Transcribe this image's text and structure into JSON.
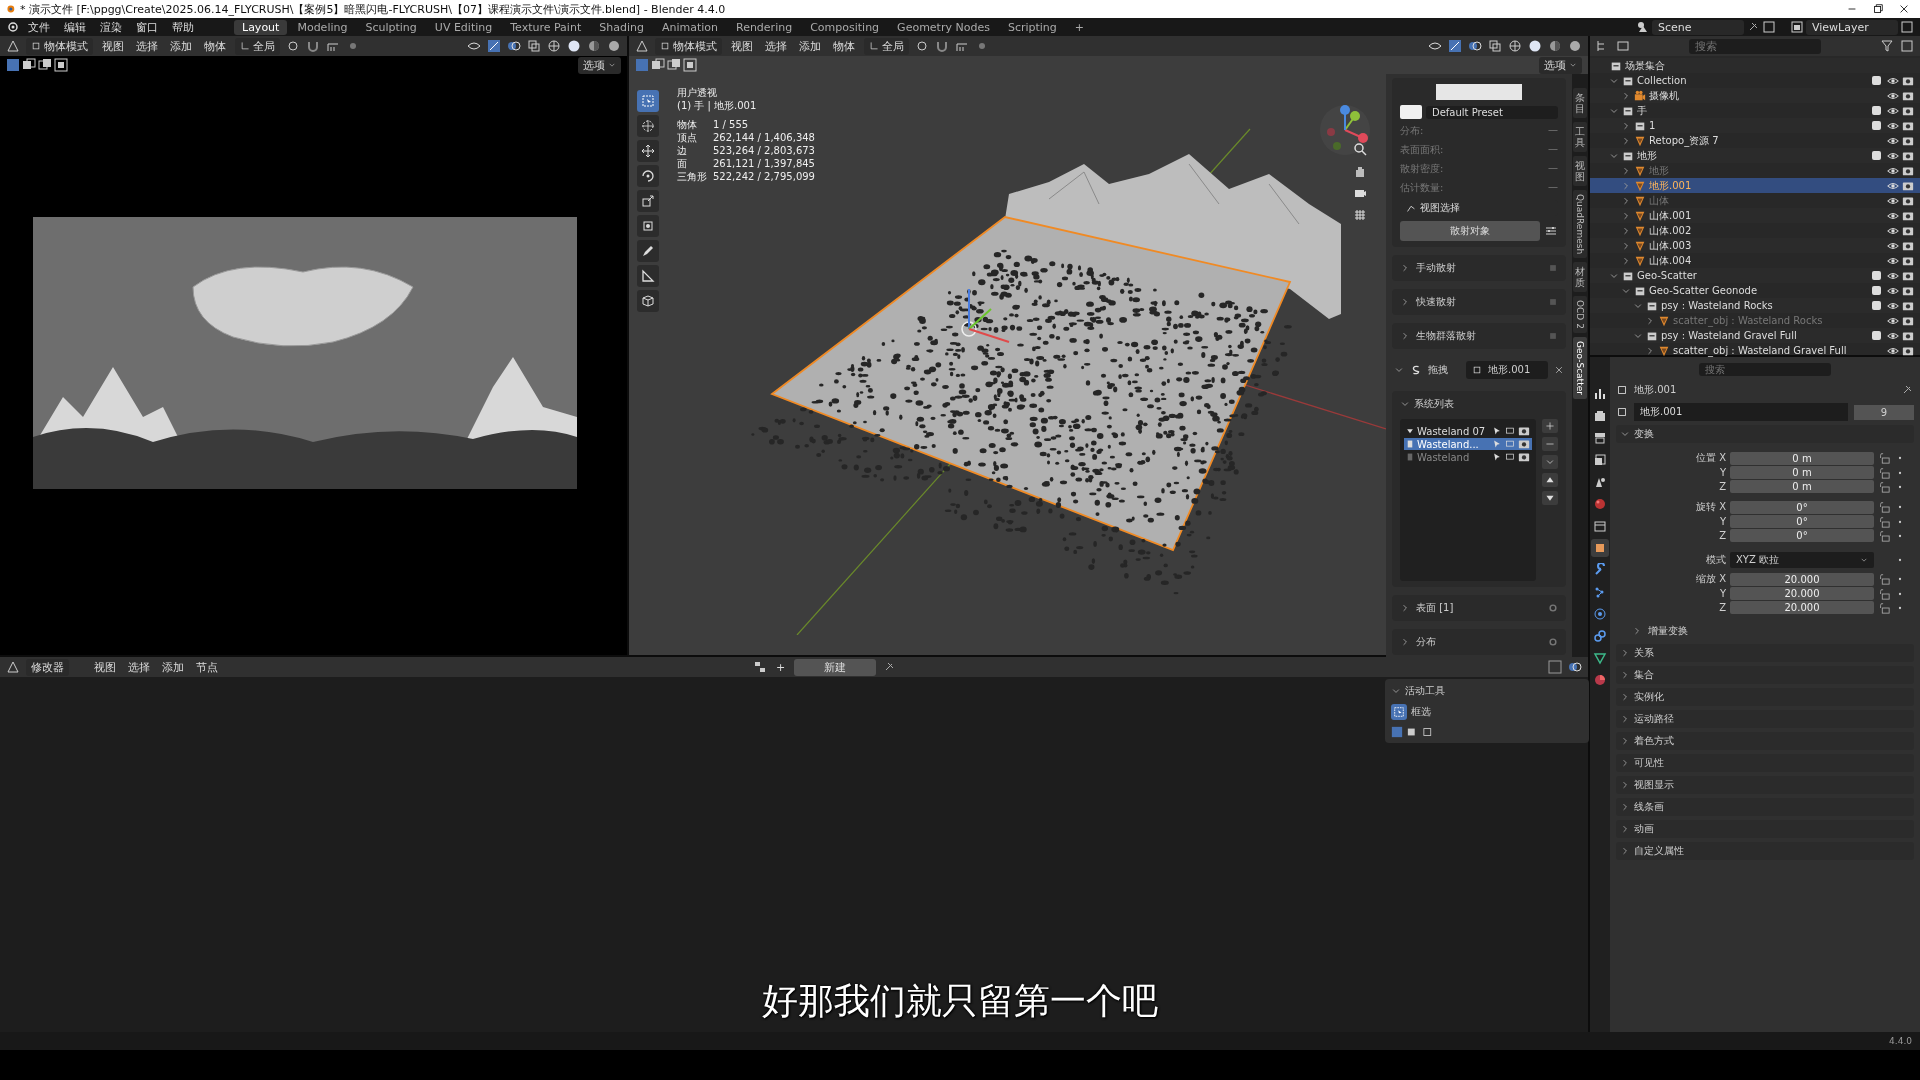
{
  "title_bar": {
    "title": "* 演示文件 [F:\\ppgg\\Create\\2025.06.14_FLYCRUSH\\【案例5】暗黑闪电-FLYCRUSH\\【07】课程演示文件\\演示文件.blend] - Blender 4.4.0"
  },
  "menu_bar": {
    "menus": [
      "文件",
      "编辑",
      "渲染",
      "窗口",
      "帮助"
    ],
    "workspaces": [
      {
        "label": "Layout",
        "selected": true
      },
      {
        "label": "Modeling",
        "selected": false
      },
      {
        "label": "Sculpting",
        "selected": false
      },
      {
        "label": "UV Editing",
        "selected": false
      },
      {
        "label": "Texture Paint",
        "selected": false
      },
      {
        "label": "Shading",
        "selected": false
      },
      {
        "label": "Animation",
        "selected": false
      },
      {
        "label": "Rendering",
        "selected": false
      },
      {
        "label": "Compositing",
        "selected": false
      },
      {
        "label": "Geometry Nodes",
        "selected": false
      },
      {
        "label": "Scripting",
        "selected": false
      }
    ],
    "add_tab": "+",
    "scene": "Scene",
    "view_layer": "ViewLayer"
  },
  "left_viewport": {
    "mode": "物体模式",
    "menus": [
      "视图",
      "选择",
      "添加",
      "物体"
    ],
    "orientation": "全局",
    "options": "选项"
  },
  "main_viewport": {
    "mode": "物体模式",
    "menus": [
      "视图",
      "选择",
      "添加",
      "物体"
    ],
    "orientation": "全局",
    "options": "选项",
    "view_name": "用户透视",
    "object_info": "(1) 手 | 地形.001",
    "stats": [
      {
        "label": "物体",
        "value": "1 / 555"
      },
      {
        "label": "顶点",
        "value": "262,144 / 1,406,348"
      },
      {
        "label": "边",
        "value": "523,264 / 2,803,673"
      },
      {
        "label": "面",
        "value": "261,121 / 1,397,845"
      },
      {
        "label": "三角形",
        "value": "522,242 / 2,795,099"
      }
    ],
    "tools": [
      {
        "kind": "select",
        "selected": true
      },
      {
        "kind": "cursor",
        "selected": false
      },
      {
        "kind": "move",
        "selected": false
      },
      {
        "kind": "rotate",
        "selected": false
      },
      {
        "kind": "scale",
        "selected": false
      },
      {
        "kind": "transform",
        "selected": false
      },
      {
        "kind": "annotate",
        "selected": false
      },
      {
        "kind": "measure",
        "selected": false
      },
      {
        "kind": "add_cube",
        "selected": false
      }
    ]
  },
  "sidebar": {
    "tabs": [
      {
        "label": "条目",
        "kind": "cjk",
        "selected": false
      },
      {
        "label": "工具",
        "kind": "cjk",
        "selected": false
      },
      {
        "label": "视图",
        "kind": "cjk",
        "selected": false
      },
      {
        "label": "QuadRemesh",
        "kind": "latin",
        "selected": false
      },
      {
        "label": "材质",
        "kind": "cjk",
        "selected": false
      },
      {
        "label": "OCD 2",
        "kind": "latin",
        "selected": false
      },
      {
        "label": "Geo-Scatter",
        "kind": "latin",
        "selected": true
      }
    ],
    "preset": "Default Preset",
    "info": [
      {
        "label": "分布:",
        "value": "—"
      },
      {
        "label": "表面面积:",
        "value": "—"
      },
      {
        "label": "散射密度:",
        "value": "—"
      },
      {
        "label": "估计数量:",
        "value": "—"
      }
    ],
    "view_select": "视图选择",
    "scatter_button": "散射对象",
    "sections": [
      "手动散射",
      "快速散射",
      "生物群落散射"
    ],
    "target": {
      "label": "拖拽",
      "value": "地形.001"
    },
    "system_list": {
      "title": "系统列表",
      "items": [
        {
          "name": "Wasteland 07",
          "kind": "group",
          "selected": false,
          "hidden": false
        },
        {
          "name": "Wasteland...",
          "kind": "system",
          "selected": true,
          "hidden": false
        },
        {
          "name": "Wasteland",
          "kind": "system",
          "selected": false,
          "hidden": true
        }
      ]
    },
    "lower_sections": [
      "表面 [1]",
      "分布"
    ]
  },
  "outliner": {
    "search_placeholder": "搜索",
    "tree": [
      {
        "name": "场景集合",
        "kind": "scene",
        "selected": false,
        "hidden": false,
        "children": [
          {
            "name": "Collection",
            "kind": "collection",
            "expanded": true,
            "checked": true,
            "selected": false,
            "hidden": false,
            "children": [
              {
                "name": "摄像机",
                "kind": "camera",
                "expanded": false,
                "selected": false,
                "hidden": false
              }
            ]
          },
          {
            "name": "手",
            "kind": "collection",
            "expanded": true,
            "checked": true,
            "selected": false,
            "hidden": false,
            "children": [
              {
                "name": "1",
                "kind": "collection",
                "expanded": false,
                "checked": true,
                "selected": false,
                "hidden": false
              },
              {
                "name": "Retopo_资源 7",
                "kind": "mesh",
                "expanded": false,
                "selected": false,
                "hidden": false
              }
            ]
          },
          {
            "name": "地形",
            "kind": "collection",
            "expanded": true,
            "checked": true,
            "selected": false,
            "hidden": false,
            "children": [
              {
                "name": "地形",
                "kind": "mesh",
                "expanded": false,
                "selected": false,
                "hidden": true
              },
              {
                "name": "地形.001",
                "kind": "mesh",
                "expanded": false,
                "selected": true,
                "hidden": false
              },
              {
                "name": "山体",
                "kind": "mesh",
                "expanded": false,
                "selected": false,
                "hidden": true
              },
              {
                "name": "山体.001",
                "kind": "mesh",
                "expanded": false,
                "selected": false,
                "hidden": false
              },
              {
                "name": "山体.002",
                "kind": "mesh",
                "expanded": false,
                "selected": false,
                "hidden": false
              },
              {
                "name": "山体.003",
                "kind": "mesh",
                "expanded": false,
                "selected": false,
                "hidden": false
              },
              {
                "name": "山体.004",
                "kind": "mesh",
                "expanded": false,
                "selected": false,
                "hidden": false
              }
            ]
          },
          {
            "name": "Geo-Scatter",
            "kind": "collection",
            "expanded": true,
            "checked": true,
            "selected": false,
            "hidden": false,
            "children": [
              {
                "name": "Geo-Scatter Geonode",
                "kind": "collection",
                "expanded": true,
                "checked": true,
                "selected": false,
                "hidden": false,
                "children": [
                  {
                    "name": "psy : Wasteland Rocks",
                    "kind": "collection",
                    "expanded": true,
                    "checked": true,
                    "selected": false,
                    "hidden": false,
                    "children": [
                      {
                        "name": "scatter_obj : Wasteland Rocks",
                        "kind": "mesh",
                        "expanded": false,
                        "selected": false,
                        "hidden": true
                      }
                    ]
                  },
                  {
                    "name": "psy : Wasteland Gravel Full",
                    "kind": "collection",
                    "expanded": true,
                    "checked": true,
                    "selected": false,
                    "hidden": false,
                    "children": [
                      {
                        "name": "scatter_obj : Wasteland Gravel Full",
                        "kind": "mesh",
                        "expanded": false,
                        "selected": false,
                        "hidden": false
                      }
                    ]
                  }
                ]
              }
            ]
          }
        ]
      }
    ]
  },
  "properties": {
    "search_placeholder": "搜索",
    "tabs": [
      {
        "kind": "tool",
        "selected": false
      },
      {
        "kind": "render",
        "selected": false
      },
      {
        "kind": "output",
        "selected": false
      },
      {
        "kind": "view_layer",
        "selected": false
      },
      {
        "kind": "scene",
        "selected": false
      },
      {
        "kind": "world",
        "selected": false
      },
      {
        "kind": "collection",
        "selected": false
      },
      {
        "kind": "object",
        "selected": true
      },
      {
        "kind": "modifier",
        "selected": false
      },
      {
        "kind": "particles",
        "selected": false
      },
      {
        "kind": "physics",
        "selected": false
      },
      {
        "kind": "constraints",
        "selected": false
      },
      {
        "kind": "data",
        "selected": false
      },
      {
        "kind": "material",
        "selected": false
      }
    ],
    "object_name": "地形.001",
    "data_name": "地形.001",
    "users": "9",
    "transform": {
      "title": "变换",
      "rows": [
        {
          "label": "位置 X",
          "value": "0 m",
          "kind": "field"
        },
        {
          "label": "Y",
          "value": "0 m",
          "kind": "field"
        },
        {
          "label": "Z",
          "value": "0 m",
          "kind": "field"
        },
        {
          "label": "旋转 X",
          "value": "0°",
          "kind": "field"
        },
        {
          "label": "Y",
          "value": "0°",
          "kind": "field"
        },
        {
          "label": "Z",
          "value": "0°",
          "kind": "field"
        },
        {
          "label": "模式",
          "value": "XYZ 欧拉",
          "kind": "dropdown"
        },
        {
          "label": "缩放 X",
          "value": "20.000",
          "kind": "field"
        },
        {
          "label": "Y",
          "value": "20.000",
          "kind": "field"
        },
        {
          "label": "Z",
          "value": "20.000",
          "kind": "field"
        }
      ],
      "delta": "增量变换"
    },
    "sections": [
      "关系",
      "集合",
      "实例化",
      "运动路径",
      "着色方式",
      "可见性",
      "视图显示",
      "线条画",
      "动画",
      "自定义属性"
    ]
  },
  "bottom_editor": {
    "editor": "修改器",
    "menus": [
      "视图",
      "选择",
      "添加",
      "节点"
    ],
    "add": "+",
    "new_button": "新建",
    "active_tool": {
      "title": "活动工具",
      "tool": "框选"
    }
  },
  "subtitle": "好那我们就只留第一个吧",
  "status_bar": {
    "version": "4.4.0"
  }
}
